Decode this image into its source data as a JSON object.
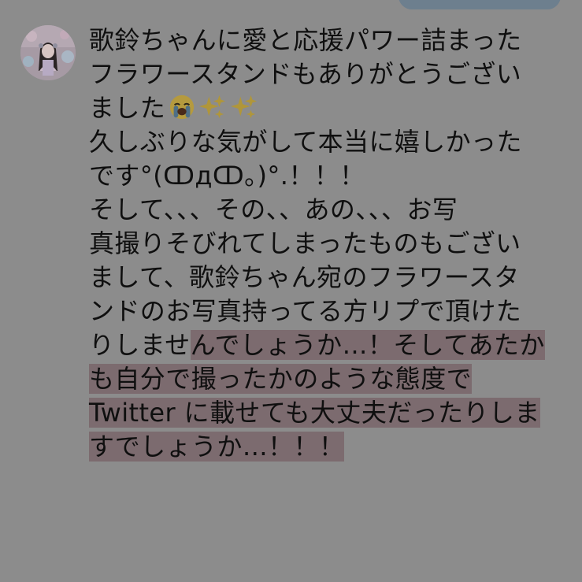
{
  "colors": {
    "overlay_background": "#8c8c8c",
    "top_bubble": "#6d7f8e",
    "highlight": "#7c6b6f",
    "text": "#0f0f0f"
  },
  "avatar": {
    "icon": "profile-photo-avatar"
  },
  "message": {
    "lines": [
      {
        "text": "歌鈴ちゃんに愛と応援パワー詰まった"
      },
      {
        "text": "フラワースタンドもありがとうござい"
      },
      {
        "text": "ました",
        "emojis": [
          "loudly-crying-face-icon",
          "sparkles-icon",
          "sparkles-icon"
        ]
      },
      {
        "text": "久しぶりな気がして本当に嬉しかった"
      },
      {
        "text": "です°(ↀдↀ。)°.！！！"
      },
      {
        "text": "そして、、、その、、あの、、、お写"
      },
      {
        "text": "真撮りそびれてしまったものもござい"
      },
      {
        "text": "まして、歌鈴ちゃん宛のフラワースタ"
      },
      {
        "text": "ンドのお写真持ってる方リプで頂けた"
      },
      {
        "before": "りしませ",
        "highlight": "んでしょうか…！そしてあたか"
      },
      {
        "highlight": "も自分で撮ったかのような態度で"
      },
      {
        "highlight": "Twitter に載せても大丈夫だったりしま"
      },
      {
        "highlight": "すでしょうか…！！！"
      }
    ]
  }
}
